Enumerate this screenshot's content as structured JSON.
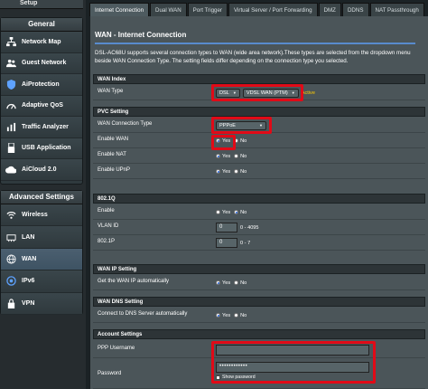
{
  "sidebar": {
    "setup_label": "Setup",
    "general_title": "General",
    "general_items": [
      {
        "label": "Network Map",
        "icon": "network-map-icon"
      },
      {
        "label": "Guest Network",
        "icon": "guest-network-icon"
      },
      {
        "label": "AiProtection",
        "icon": "aiprotection-icon"
      },
      {
        "label": "Adaptive QoS",
        "icon": "adaptive-qos-icon"
      },
      {
        "label": "Traffic Analyzer",
        "icon": "traffic-analyzer-icon"
      },
      {
        "label": "USB Application",
        "icon": "usb-application-icon"
      },
      {
        "label": "AiCloud 2.0",
        "icon": "aicloud-icon"
      }
    ],
    "advanced_title": "Advanced Settings",
    "advanced_items": [
      {
        "label": "Wireless",
        "icon": "wireless-icon"
      },
      {
        "label": "LAN",
        "icon": "lan-icon"
      },
      {
        "label": "WAN",
        "icon": "wan-icon",
        "active": true
      },
      {
        "label": "IPv6",
        "icon": "ipv6-icon"
      },
      {
        "label": "VPN",
        "icon": "vpn-icon"
      }
    ]
  },
  "tabs": [
    "Internet Connection",
    "Dual WAN",
    "Port Trigger",
    "Virtual Server / Port Forwarding",
    "DMZ",
    "DDNS",
    "NAT Passthrough"
  ],
  "page": {
    "title": "WAN - Internet Connection",
    "description": "DSL-AC68U supports several connection types to WAN (wide area network).These types are selected from the dropdown menu beside WAN Connection Type. The setting fields differ depending on the connection type you selected."
  },
  "sections": {
    "wan_index": "WAN Index",
    "pvc": "PVC Setting",
    "dot1q": "802.1Q",
    "wan_ip": "WAN IP Setting",
    "wan_dns": "WAN DNS Setting",
    "account": "Account Settings"
  },
  "fields": {
    "wan_type": {
      "label": "WAN Type",
      "type_value": "DSL",
      "mode_value": "VDSL WAN (PTM)",
      "status": "Active"
    },
    "conn_type": {
      "label": "WAN Connection Type",
      "value": "PPPoE"
    },
    "enable_wan": {
      "label": "Enable WAN",
      "yes": "Yes",
      "no": "No"
    },
    "enable_nat": {
      "label": "Enable NAT",
      "yes": "Yes",
      "no": "No"
    },
    "enable_upnp": {
      "label": "Enable UPnP",
      "yes": "Yes",
      "no": "No"
    },
    "enable_8021q": {
      "label": "Enable",
      "yes": "Yes",
      "no": "No"
    },
    "vlan_id": {
      "label": "VLAN ID",
      "value": "0",
      "hint": "0 - 4095"
    },
    "p8021": {
      "label": "802.1P",
      "value": "0",
      "hint": "0 - 7"
    },
    "wan_ip_auto": {
      "label": "Get the WAN IP automatically",
      "yes": "Yes",
      "no": "No"
    },
    "dns_auto": {
      "label": "Connect to DNS Server automatically",
      "yes": "Yes",
      "no": "No"
    },
    "ppp_user": {
      "label": "PPP Username",
      "value": ""
    },
    "password": {
      "label": "Password",
      "value": "••••••••••••",
      "show": "Show password"
    }
  },
  "colors": {
    "highlight": "#e10a17",
    "accent": "#5ea2ff",
    "active_status": "#ffcc00"
  }
}
